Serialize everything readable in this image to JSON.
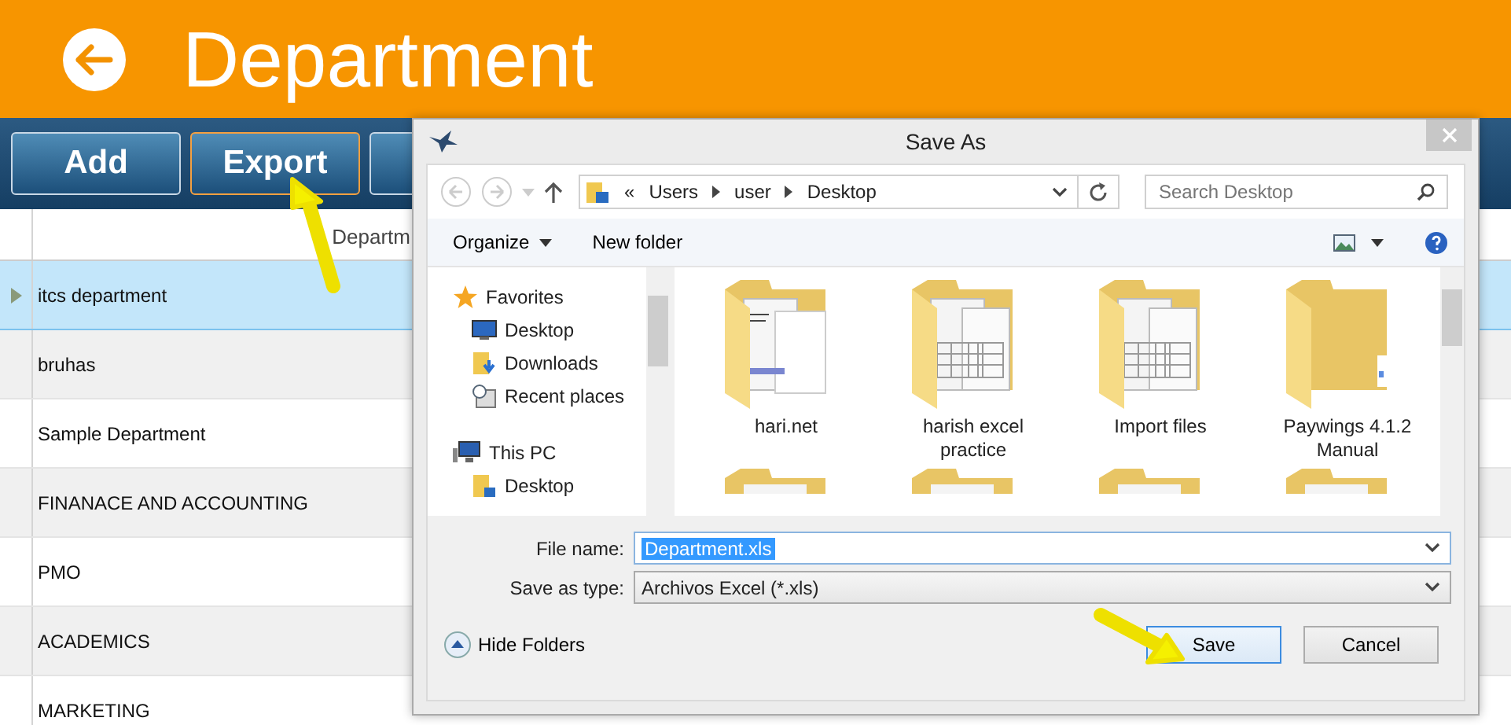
{
  "app": {
    "title": "Department"
  },
  "toolbar": [
    {
      "label": "Add",
      "highlighted": false
    },
    {
      "label": "Export",
      "highlighted": true
    }
  ],
  "table": {
    "columns": [
      "Departm"
    ],
    "rows": [
      {
        "name": "itcs department",
        "selected": true
      },
      {
        "name": "bruhas",
        "selected": false
      },
      {
        "name": "Sample Department",
        "selected": false
      },
      {
        "name": "FINANACE AND ACCOUNTING",
        "selected": false
      },
      {
        "name": "PMO",
        "selected": false
      },
      {
        "name": "ACADEMICS",
        "selected": false
      },
      {
        "name": "MARKETING",
        "selected": false
      }
    ]
  },
  "dialog": {
    "title": "Save As",
    "address": [
      "«",
      "Users",
      "user",
      "Desktop"
    ],
    "search": {
      "placeholder": "Search Desktop"
    },
    "commands": [
      "Organize",
      "New folder"
    ],
    "nav": [
      {
        "label": "Favorites",
        "kind": "star",
        "children": [
          {
            "label": "Desktop",
            "kind": "desktop"
          },
          {
            "label": "Downloads",
            "kind": "downloads"
          },
          {
            "label": "Recent places",
            "kind": "recent"
          }
        ]
      },
      {
        "label": "This PC",
        "kind": "pc",
        "children": [
          {
            "label": "Desktop",
            "kind": "folder"
          }
        ]
      }
    ],
    "files": [
      {
        "name": "hari.net",
        "kind": "docs"
      },
      {
        "name": "harish excel practice",
        "kind": "sheets"
      },
      {
        "name": "Import files",
        "kind": "sheets"
      },
      {
        "name": "Paywings 4.1.2 Manual",
        "kind": "empty"
      }
    ],
    "file_name": {
      "label": "File name:",
      "value": "Department.xls",
      "selected": true
    },
    "save_type": {
      "label": "Save as type:",
      "value": "Archivos Excel (*.xls)"
    },
    "hide_folders": "Hide Folders",
    "buttons": [
      {
        "label": "Save",
        "default": true
      },
      {
        "label": "Cancel",
        "default": false
      }
    ]
  }
}
